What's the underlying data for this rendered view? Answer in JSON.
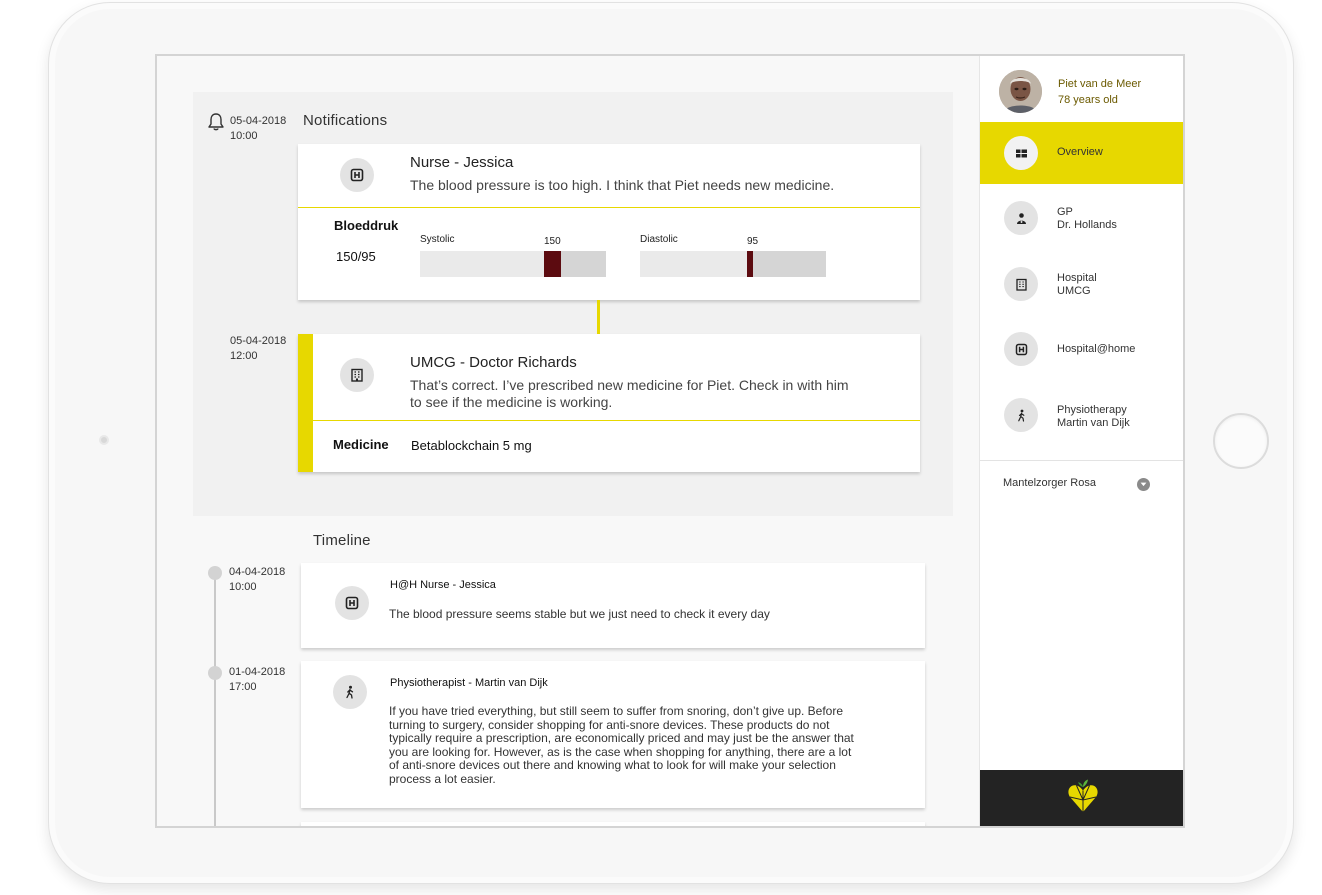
{
  "notifications": {
    "title": "Notifications",
    "items": [
      {
        "date": "05-04-2018",
        "time": "10:00",
        "author": "Nurse - Jessica",
        "icon": "hospital-h-icon",
        "message": "The blood pressure is too high. I think that Piet needs new medicine.",
        "vital": {
          "label": "Bloeddruk",
          "value": "150/95",
          "systolic_label": "Systolic",
          "systolic_value": "150",
          "diastolic_label": "Diastolic",
          "diastolic_value": "95"
        }
      },
      {
        "date": "05-04-2018",
        "time": "12:00",
        "author": "UMCG - Doctor Richards",
        "icon": "hospital-building-icon",
        "message": "That’s correct. I’ve prescribed new medicine for Piet. Check in with him to see if the medicine is working.",
        "medicine_label": "Medicine",
        "medicine_value": "Betablockchain 5 mg"
      }
    ]
  },
  "timeline": {
    "title": "Timeline",
    "items": [
      {
        "date": "04-04-2018",
        "time": "10:00",
        "author": "H@H Nurse - Jessica",
        "icon": "hospital-h-icon",
        "message": "The blood pressure seems stable but we just need to check it every day"
      },
      {
        "date": "01-04-2018",
        "time": "17:00",
        "author": "Physiotherapist - Martin van Dijk",
        "icon": "walking-person-icon",
        "message": "If you have tried everything, but still seem to suffer from snoring, don’t give up. Before turning to surgery, consider shopping for anti-snore devices. These products do not typically require a prescription, are economically priced and may just be the answer that you are looking for. However, as is the case when shopping for anything, there are a lot of anti-snore devices out there and knowing what to look for will make your selection process a lot easier."
      }
    ]
  },
  "sidebar": {
    "user": {
      "name": "Piet van de Meer",
      "age": "78 years old"
    },
    "items": [
      {
        "label": "Overview",
        "icon": "grid-icon",
        "active": true
      },
      {
        "label": "GP",
        "sublabel": "Dr. Hollands",
        "icon": "doctor-icon"
      },
      {
        "label": "Hospital",
        "sublabel": "UMCG",
        "icon": "hospital-building-icon"
      },
      {
        "label": "Hospital@home",
        "icon": "hospital-h-icon"
      },
      {
        "label": "Physiotherapy",
        "sublabel": "Martin van Dijk",
        "icon": "walking-person-icon"
      }
    ],
    "caregiver": "Mantelzorger Rosa"
  },
  "colors": {
    "accent": "#e7d800",
    "bar_marker": "#5c0b10",
    "footer": "#232323"
  }
}
